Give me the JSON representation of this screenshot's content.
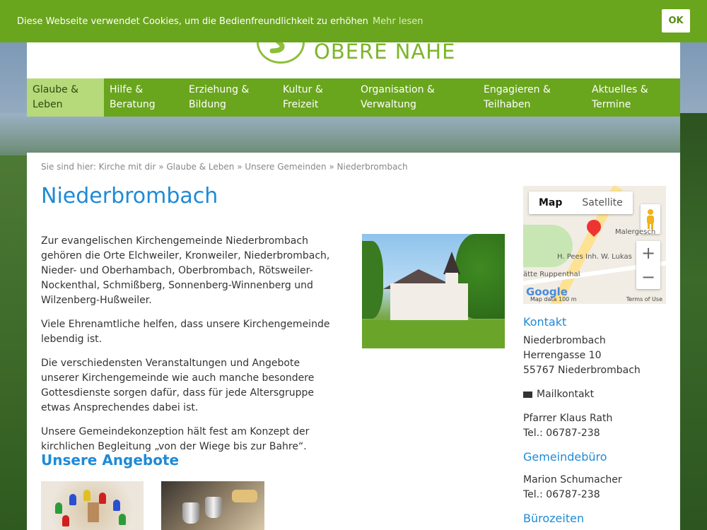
{
  "cookie": {
    "message": "Diese Webseite verwendet Cookies, um die Bedienfreundlichkeit zu erhöhen",
    "more_link": "Mehr lesen",
    "ok_label": "OK"
  },
  "logo": {
    "text": "OBERE NAHE"
  },
  "nav": {
    "items": [
      {
        "line1": "Glaube &",
        "line2": "Leben"
      },
      {
        "line1": "Hilfe &",
        "line2": "Beratung"
      },
      {
        "line1": "Erziehung &",
        "line2": "Bildung"
      },
      {
        "line1": "Kultur &",
        "line2": "Freizeit"
      },
      {
        "line1": "Organisation &",
        "line2": "Verwaltung"
      },
      {
        "line1": "Engagieren &",
        "line2": "Teilhaben"
      },
      {
        "line1": "Aktuelles &",
        "line2": "Termine"
      }
    ]
  },
  "breadcrumb": "Sie sind hier: Kirche mit dir » Glaube & Leben » Unsere Gemeinden » Niederbrombach",
  "page": {
    "title": "Niederbrombach",
    "paragraphs": [
      "Zur evangelischen Kirchengemeinde Niederbrombach gehören die Orte Elchweiler, Kronweiler, Niederbrombach, Nieder- und Oberhambach, Oberbrombach, Rötsweiler-Nockenthal, Schmißberg, Sonnenberg-Winnenberg und Wilzenberg-Hußweiler.",
      "Viele Ehrenamtliche helfen, dass unsere Kirchengemeinde lebendig ist.",
      "Die verschiedensten Veranstaltungen und Angebote unserer Kirchengemeinde wie auch manche besondere Gottesdienste sorgen dafür, dass für jede Altersgruppe etwas Ansprechendes dabei ist.",
      "Unsere Gemeindekonzeption hält fest am Konzept der kirchlichen Begleitung „von der Wiege bis zur Bahre“."
    ],
    "section_title": "Unsere Angebote"
  },
  "map": {
    "tab_map": "Map",
    "tab_satellite": "Satellite",
    "label_a": "Malergesch",
    "label_b": "H. Pees Inh. W. Lukas",
    "label_c": "ätte Ruppenthal",
    "google": "Google",
    "footer_left": "Map data  100 m",
    "footer_right": "Terms of Use",
    "zoom_in": "+",
    "zoom_out": "−"
  },
  "sidebar": {
    "kontakt_title": "Kontakt",
    "address": [
      "Niederbrombach",
      "Herrengasse 10",
      "55767 Niederbrombach"
    ],
    "mail_label": "Mailkontakt",
    "pfarrer": "Pfarrer Klaus Rath",
    "pfarrer_tel": "Tel.: 06787-238",
    "buero_title": "Gemeindebüro",
    "buero_name": "Marion Schumacher",
    "buero_tel": "Tel.: 06787-238",
    "zeiten_title": "Bürozeiten"
  },
  "colors": {
    "brand_green": "#6aa51e",
    "active_nav": "#b6d97a",
    "link_blue": "#1f8ad6"
  }
}
